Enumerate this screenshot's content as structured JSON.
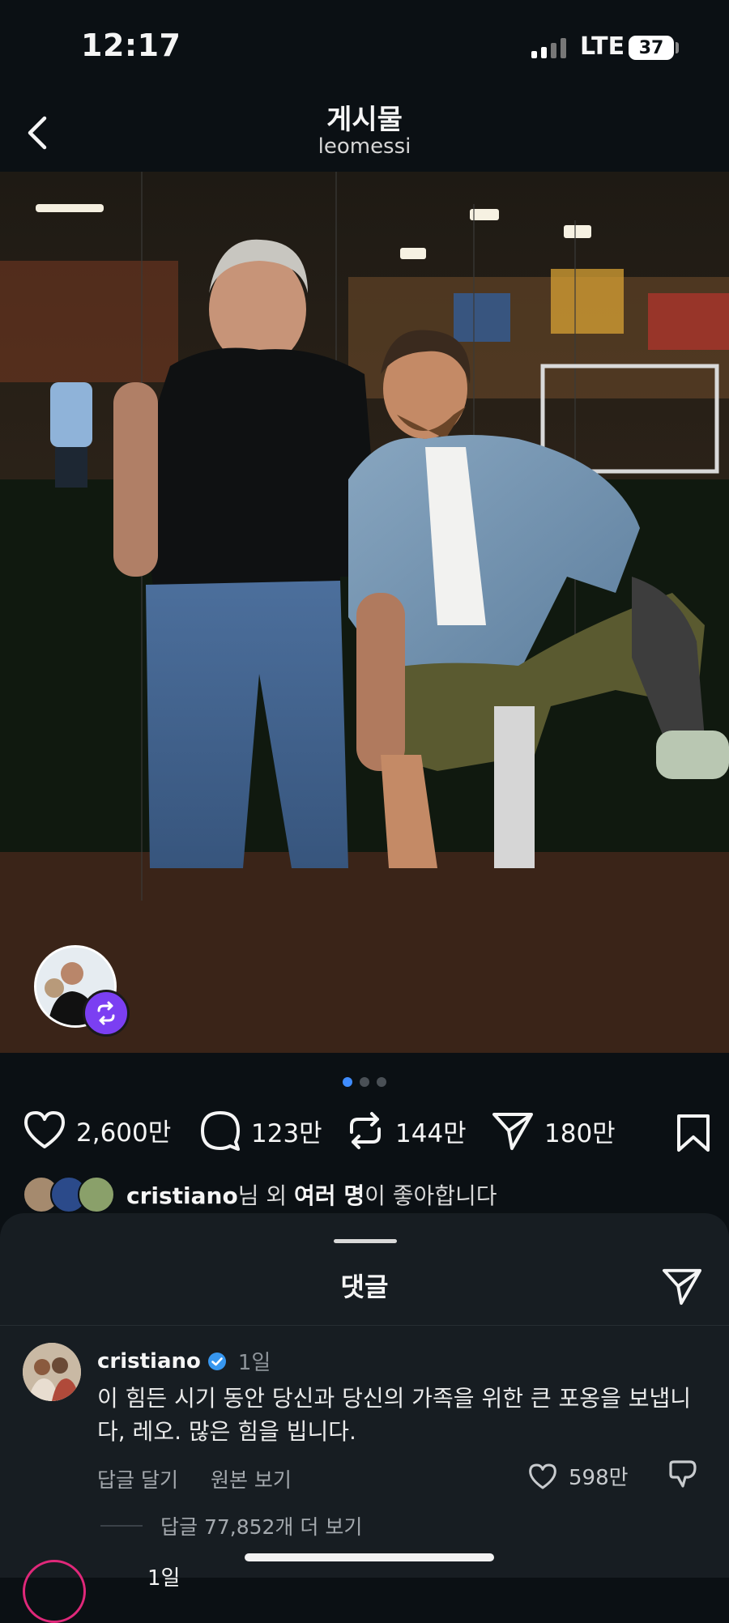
{
  "status": {
    "time": "12:17",
    "network": "LTE",
    "battery": "37"
  },
  "header": {
    "title": "게시물",
    "subtitle": "leomessi"
  },
  "post": {
    "carousel": {
      "count": 3,
      "active_index": 0
    },
    "likes_count": "2,600만",
    "comments_count": "123만",
    "reposts_count": "144만",
    "shares_count": "180만",
    "liked_by": {
      "user": "cristiano",
      "mid1": "님 외 ",
      "others": "여러 명",
      "mid2": "이 좋아합니다"
    }
  },
  "comments_sheet": {
    "title": "댓글",
    "comment": {
      "username": "cristiano",
      "verified": true,
      "time": "1일",
      "text": "이 힘든 시기 동안 당신과 당신의 가족을 위한 큰 포옹을 보냅니다, 레오. 많은 힘을 빕니다.",
      "reply_label": "답글 달기",
      "translate_label": "원본 보기",
      "like_count": "598만",
      "more_replies": "답글 77,852개 더 보기"
    },
    "next_comment_time": "1일"
  },
  "colors": {
    "background": "#0b1014",
    "sheet": "#171d22",
    "active_dot": "#3f8cff",
    "verified": "#3797f0",
    "remix_badge": "#7b3ff2"
  },
  "icons": [
    "back-chevron-icon",
    "heart-icon",
    "comment-bubble-icon",
    "repost-icon",
    "send-icon",
    "bookmark-icon",
    "verified-badge-icon",
    "dislike-icon",
    "remix-icon"
  ]
}
